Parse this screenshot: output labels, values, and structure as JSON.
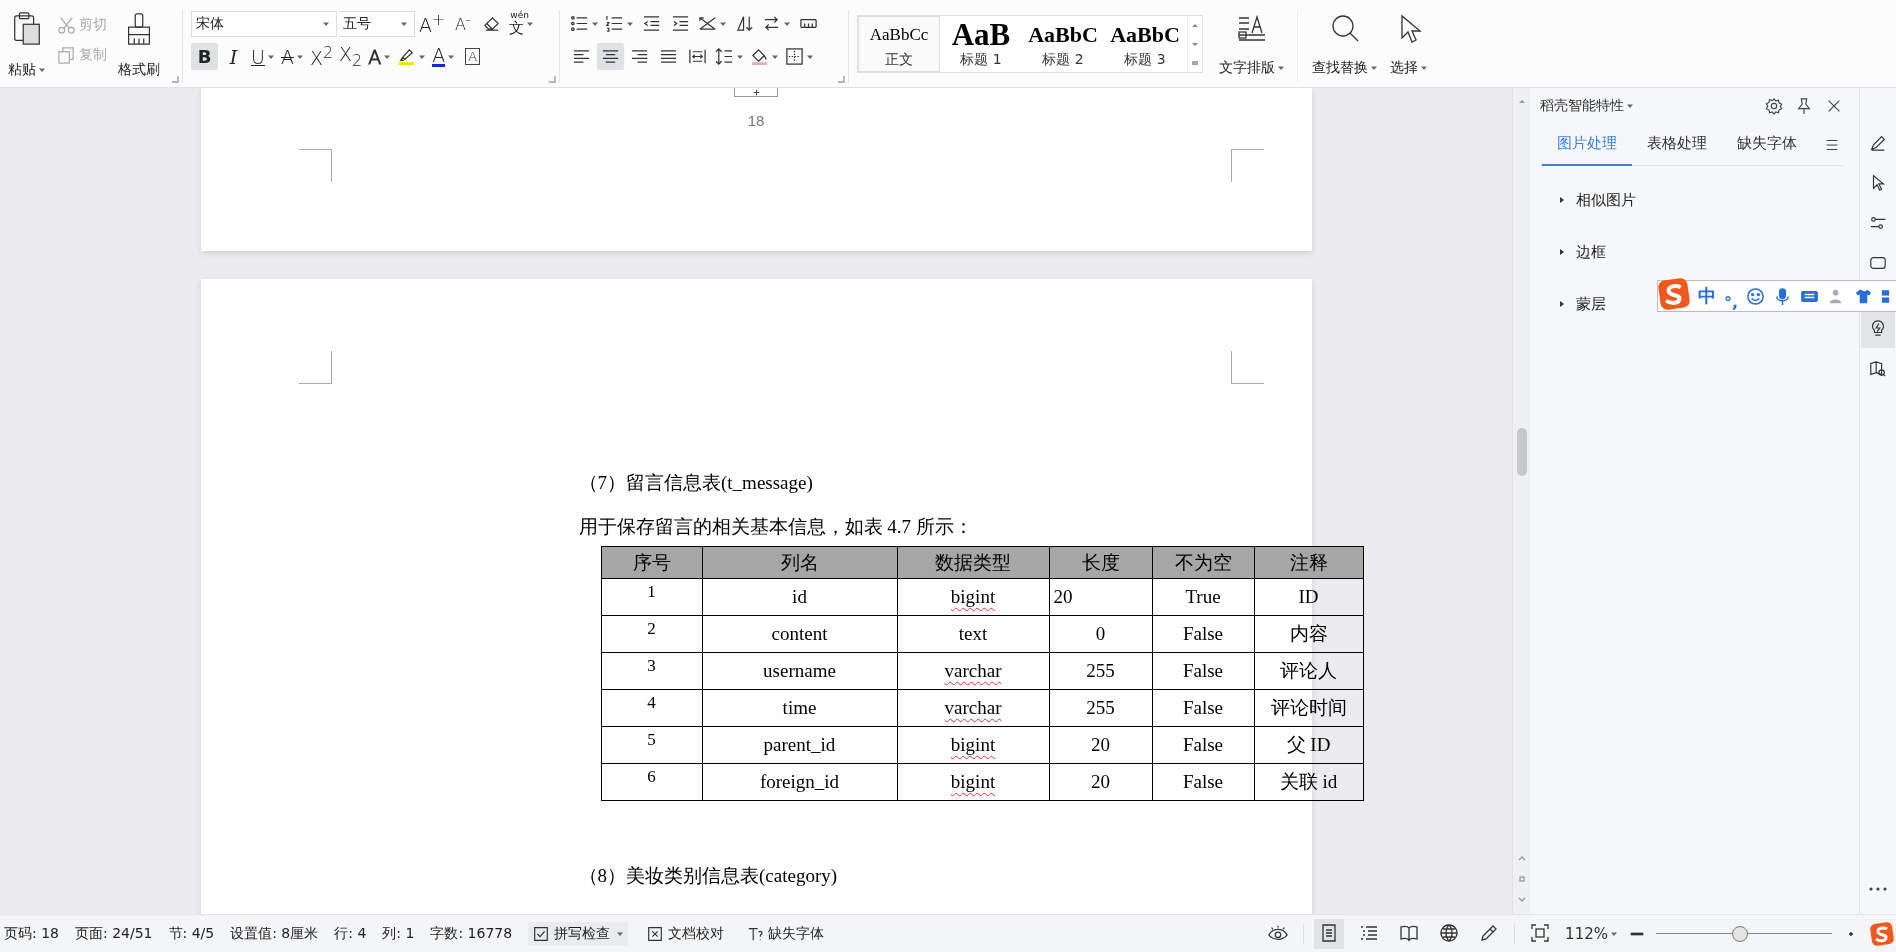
{
  "toolbar": {
    "paste": "粘贴",
    "cut": {
      "label": "剪切",
      "disabled": true
    },
    "copy": {
      "label": "复制",
      "disabled": true
    },
    "format_painter": "格式刷",
    "font_name": "宋体",
    "font_size": "五号",
    "size_buttons": [
      {
        "kind": "grow",
        "glyph": "A$^{+}$"
      },
      {
        "kind": "shrink",
        "glyph": "A$^{-}$"
      }
    ],
    "pinyin": {
      "pinyin": "wén",
      "char": "文"
    },
    "format_buttons": [
      {
        "kind": "bold",
        "glyph": "B",
        "selected": true,
        "dropdown": false
      },
      {
        "kind": "italic",
        "glyph": "I",
        "selected": false,
        "dropdown": false
      },
      {
        "kind": "underline",
        "glyph": "U",
        "selected": false,
        "dropdown": true
      },
      {
        "kind": "strike",
        "glyph": "A",
        "selected": false,
        "dropdown": true
      },
      {
        "kind": "superscript",
        "glyph": "X$^{2}$",
        "selected": false,
        "dropdown": false
      },
      {
        "kind": "subscript",
        "glyph": "X$_{2}$",
        "selected": false,
        "dropdown": false
      },
      {
        "kind": "effects",
        "glyph": "A",
        "selected": false,
        "dropdown": true
      },
      {
        "kind": "highlight",
        "selected": false,
        "dropdown": true
      },
      {
        "kind": "color",
        "glyph": "A",
        "selected": false,
        "dropdown": true
      },
      {
        "kind": "border",
        "glyph": "A",
        "selected": false,
        "dropdown": false
      }
    ],
    "align_buttons": [
      {
        "kind": "left",
        "selected": false
      },
      {
        "kind": "center",
        "selected": true
      },
      {
        "kind": "right",
        "selected": false
      },
      {
        "kind": "justify",
        "selected": false
      },
      {
        "kind": "distribute",
        "selected": false
      }
    ],
    "styles": [
      {
        "kind": "body",
        "preview": "AaBbCc",
        "label": "正文",
        "selected": true
      },
      {
        "kind": "h1",
        "preview": "AaB",
        "label": "标题 1",
        "selected": false
      },
      {
        "kind": "h2",
        "preview": "AaBbC",
        "label": "标题 2",
        "selected": false
      },
      {
        "kind": "h3",
        "preview": "AaBbC",
        "label": "标题 3",
        "selected": false
      }
    ],
    "text_layout": "文字排版",
    "find_replace": "查找替换",
    "select": "选择"
  },
  "document": {
    "page_number": "18",
    "heading_7": "（7）留言信息表(t_message)",
    "intro_7": "用于保存留言的相关基本信息，如表 4.7 所示：",
    "table": {
      "columns": [
        "序号",
        "列名",
        "数据类型",
        "长度",
        "不为空",
        "注释"
      ],
      "rows": [
        {
          "no": "1",
          "name": "id",
          "type": "bigint",
          "type_flagged": true,
          "length": "20",
          "length_left": true,
          "not_null": "True",
          "comment": "ID"
        },
        {
          "no": "2",
          "name": "content",
          "type": "text",
          "type_flagged": false,
          "length": "0",
          "length_left": false,
          "not_null": "False",
          "comment": "内容"
        },
        {
          "no": "3",
          "name": "username",
          "type": "varchar",
          "type_flagged": true,
          "length": "255",
          "length_left": false,
          "not_null": "False",
          "comment": "评论人"
        },
        {
          "no": "4",
          "name": "time",
          "type": "varchar",
          "type_flagged": true,
          "length": "255",
          "length_left": false,
          "not_null": "False",
          "comment": "评论时间"
        },
        {
          "no": "5",
          "name": "parent_id",
          "type": "bigint",
          "type_flagged": true,
          "length": "20",
          "length_left": false,
          "not_null": "False",
          "comment": "父 ID"
        },
        {
          "no": "6",
          "name": "foreign_id",
          "type": "bigint",
          "type_flagged": true,
          "length": "20",
          "length_left": false,
          "not_null": "False",
          "comment": "关联 id"
        }
      ]
    },
    "heading_8": "（8）美妆类别信息表(category)"
  },
  "side_panel": {
    "title": "稻壳智能特性",
    "tabs": [
      {
        "label": "图片处理",
        "selected": true
      },
      {
        "label": "表格处理",
        "selected": false
      },
      {
        "label": "缺失字体",
        "selected": false
      }
    ],
    "sections": [
      {
        "label": "相似图片",
        "expanded": false
      },
      {
        "label": "边框",
        "expanded": false
      },
      {
        "label": "蒙层",
        "expanded": false
      }
    ]
  },
  "ime_bar": {
    "mode": "中",
    "punctuation": "°,"
  },
  "status_bar": {
    "fields": [
      "页码: 18",
      "页面: 24/51",
      "节: 4/5",
      "设置值: 8厘米",
      "行: 4",
      "列: 1",
      "字数: 16778"
    ],
    "tools": [
      {
        "kind": "spell",
        "label": "拼写检查",
        "dropdown": true
      },
      {
        "kind": "proof",
        "label": "文档校对",
        "dropdown": false
      },
      {
        "kind": "font",
        "label": "缺失字体",
        "dropdown": false
      }
    ],
    "view_modes": [
      {
        "kind": "page",
        "selected": true
      },
      {
        "kind": "outline",
        "selected": false
      },
      {
        "kind": "reading",
        "selected": false
      },
      {
        "kind": "web",
        "selected": false
      },
      {
        "kind": "write",
        "selected": false
      }
    ],
    "zoom": "112%",
    "zoom_slider": {
      "level": 0.48
    }
  }
}
